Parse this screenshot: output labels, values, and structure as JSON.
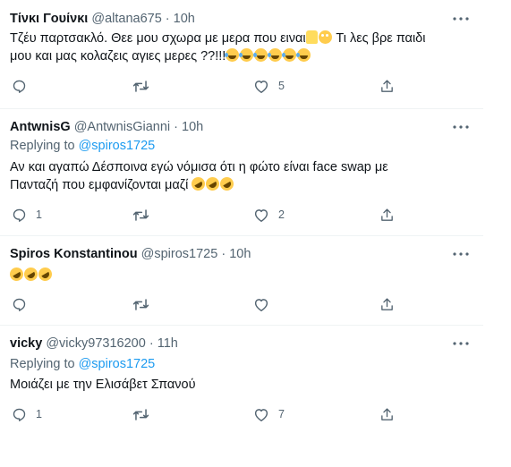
{
  "tweets": [
    {
      "name": "Τίνκι Γουίνκι",
      "handle": "@altana675",
      "separator": "·",
      "time": "10h",
      "replying_prefix": "",
      "replying_handle": "",
      "text_line1": "Τζέυ παρτσακλό. Θεε μου σχωρα με μερα που ειναι",
      "text_line1_emojis": [
        "folded-hands-emoji",
        "flushed-face-emoji"
      ],
      "text_line1_after": " Τι λες βρε παιδι",
      "text_line2": "μου και μας κολαζεις αγιες μερες ??!!!",
      "text_line2_emojis": [
        "joy-emoji",
        "joy-emoji",
        "joy-emoji",
        "joy-emoji",
        "joy-emoji",
        "joy-emoji"
      ],
      "replies": "",
      "likes": "5"
    },
    {
      "name": "AntwnisG",
      "handle": "@AntwnisGianni",
      "separator": "·",
      "time": "10h",
      "replying_prefix": "Replying to",
      "replying_handle": "@spiros1725",
      "text_line1": "Αν και αγαπώ Δέσποινα εγώ νόμισα ότι η φώτο είναι face swap με",
      "text_line2": "Πανταζή που εμφανίζονται μαζί",
      "text_line2_emojis": [
        "rofl-emoji",
        "rofl-emoji",
        "rofl-emoji"
      ],
      "replies": "1",
      "likes": "2"
    },
    {
      "name": "Spiros Konstantinou",
      "handle": "@spiros1725",
      "separator": "·",
      "time": "10h",
      "replying_prefix": "",
      "replying_handle": "",
      "text_line1": "",
      "text_line1_emojis": [
        "rofl-emoji",
        "rofl-emoji",
        "rofl-emoji"
      ],
      "replies": "",
      "likes": ""
    },
    {
      "name": "vicky",
      "handle": "@vicky97316200",
      "separator": "·",
      "time": "11h",
      "replying_prefix": "Replying to",
      "replying_handle": "@spiros1725",
      "text_line1": "Μοιάζει με την Ελισάβετ Σπανού",
      "replies": "1",
      "likes": "7"
    }
  ],
  "icons": {
    "reply": "reply-icon",
    "retweet": "retweet-icon",
    "like": "like-icon",
    "share": "share-icon",
    "more": "more-icon"
  },
  "colors": {
    "text": "#0f1419",
    "secondary": "#536471",
    "link": "#1d9bf0",
    "separator": "#eff3f4"
  }
}
